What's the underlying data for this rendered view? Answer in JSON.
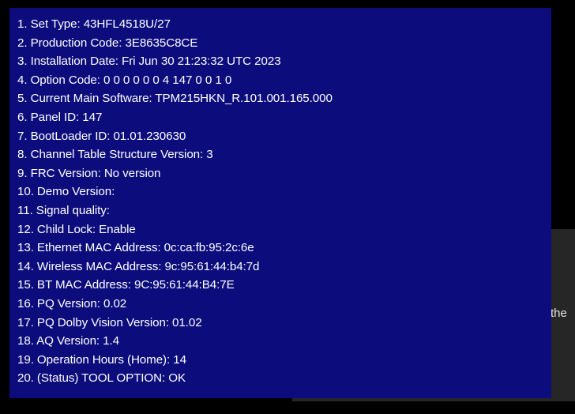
{
  "background": {
    "fragment_text": "the"
  },
  "info": {
    "lines": [
      "1. Set Type: 43HFL4518U/27",
      "2. Production Code: 3E8635C8CE",
      "3. Installation Date: Fri Jun 30 21:23:32 UTC 2023",
      "4. Option Code: 0 0 0 0 0 0 4 147 0 0 1 0",
      "5. Current Main Software: TPM215HKN_R.101.001.165.000",
      "6. Panel ID: 147",
      "7. BootLoader ID: 01.01.230630",
      "8. Channel Table Structure Version: 3",
      "9. FRC Version: No version",
      "10. Demo Version:",
      "11. Signal quality:",
      "12. Child Lock: Enable",
      "13. Ethernet MAC Address: 0c:ca:fb:95:2c:6e",
      "14. Wireless MAC Address: 9c:95:61:44:b4:7d",
      "15. BT MAC Address: 9C:95:61:44:B4:7E",
      "16. PQ Version: 0.02",
      "17. PQ Dolby Vision Version: 01.02",
      "18. AQ Version: 1.4",
      "19. Operation Hours (Home): 14",
      "20. (Status) TOOL OPTION: OK"
    ]
  },
  "colors": {
    "panel_background": "#0c0c7c",
    "text": "#ffffff",
    "screen_background": "#000000",
    "underlay_panel": "#262626"
  }
}
